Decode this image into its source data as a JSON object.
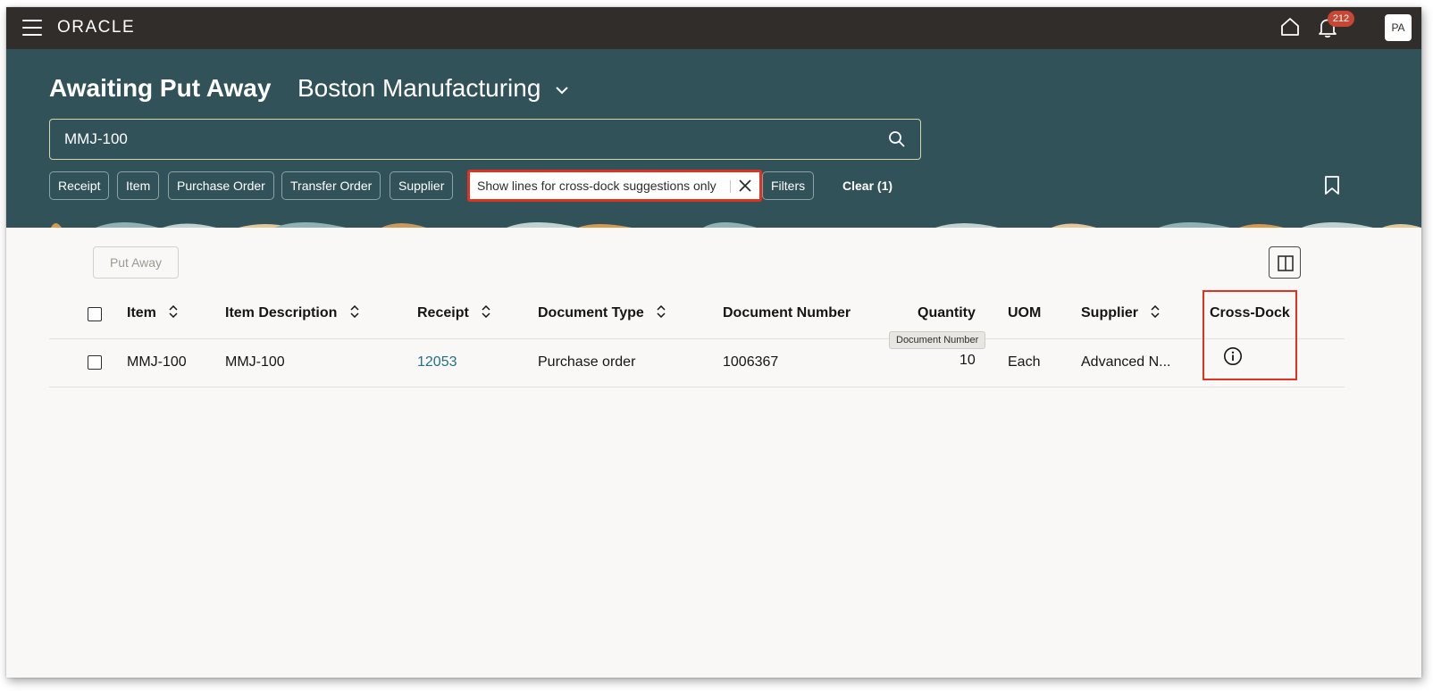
{
  "topbar": {
    "brand": "ORACLE",
    "notification_count": "212",
    "user_initials": "PA"
  },
  "header": {
    "title": "Awaiting Put Away",
    "organization": "Boston Manufacturing",
    "search": {
      "value": "MMJ-100",
      "placeholder": ""
    },
    "filter_chips": [
      "Receipt",
      "Item",
      "Purchase Order",
      "Transfer Order",
      "Supplier"
    ],
    "active_filter": "Show lines for cross-dock suggestions only",
    "filters_label": "Filters",
    "clear_label": "Clear (1)"
  },
  "toolbar": {
    "put_away_label": "Put Away"
  },
  "table": {
    "columns": {
      "item": "Item",
      "item_description": "Item Description",
      "receipt": "Receipt",
      "document_type": "Document Type",
      "document_number": "Document Number",
      "quantity": "Quantity",
      "uom": "UOM",
      "supplier": "Supplier",
      "cross_dock": "Cross-Dock"
    },
    "rows": [
      {
        "item": "MMJ-100",
        "item_description": "MMJ-100",
        "receipt": "12053",
        "document_type": "Purchase order",
        "document_number": "1006367",
        "quantity": "10",
        "uom": "Each",
        "supplier": "Advanced N..."
      }
    ],
    "tooltip": "Document Number"
  },
  "colors": {
    "topbar": "#312d2a",
    "header": "#32525a",
    "highlight": "#e1311f",
    "link": "#227187",
    "badge": "#c74634"
  },
  "icons": [
    "hamburger-icon",
    "home-icon",
    "bell-icon",
    "chevron-down-icon",
    "search-icon",
    "close-icon",
    "bookmark-icon",
    "columns-icon",
    "sort-icon",
    "info-icon"
  ]
}
